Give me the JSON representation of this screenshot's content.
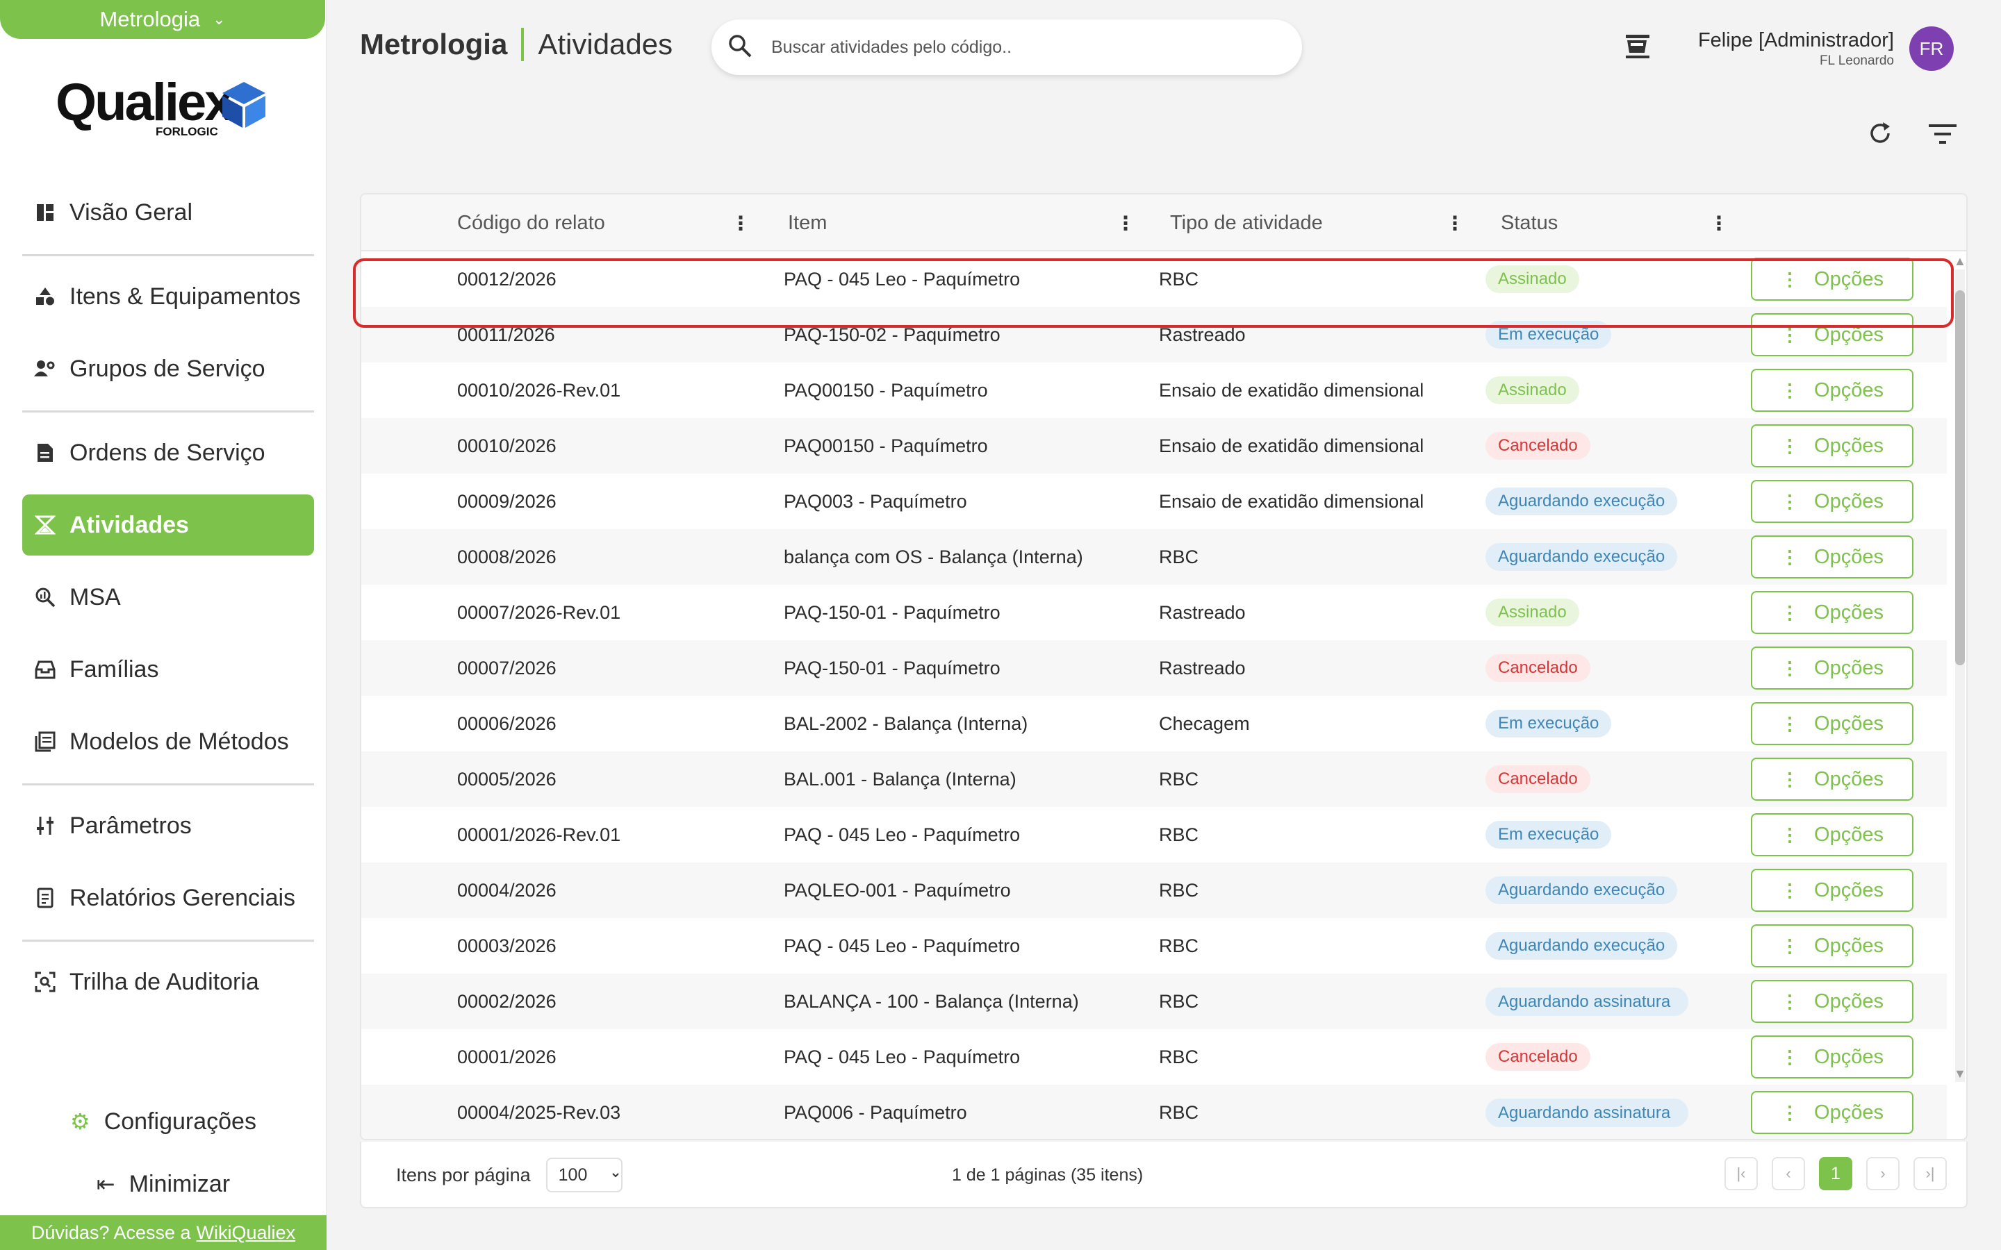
{
  "app": {
    "module": "Metrologia",
    "logo_text": "Qualiex",
    "logo_sub": "FORLOGIC"
  },
  "sidebar": {
    "items": [
      {
        "label": "Visão Geral",
        "icon": "dashboard-icon"
      },
      {
        "label": "Itens & Equipamentos",
        "icon": "shapes-icon"
      },
      {
        "label": "Grupos de Serviço",
        "icon": "people-gear-icon"
      },
      {
        "label": "Ordens de Serviço",
        "icon": "document-icon"
      },
      {
        "label": "Atividades",
        "icon": "hourglass-icon",
        "active": true
      },
      {
        "label": "MSA",
        "icon": "magnifier-chart-icon"
      },
      {
        "label": "Famílias",
        "icon": "tray-icon"
      },
      {
        "label": "Modelos de Métodos",
        "icon": "book-icon"
      },
      {
        "label": "Parâmetros",
        "icon": "sliders-icon"
      },
      {
        "label": "Relatórios Gerenciais",
        "icon": "report-icon"
      },
      {
        "label": "Trilha de Auditoria",
        "icon": "audit-scan-icon"
      }
    ],
    "settings_label": "Configurações",
    "minimize_label": "Minimizar",
    "help_text": "Dúvidas? Acesse a",
    "help_link": "WikiQualiex"
  },
  "header": {
    "module_title": "Metrologia",
    "page_title": "Atividades",
    "search_placeholder": "Buscar atividades pelo código..",
    "user_name": "Felipe [Administrador]",
    "user_org": "FL Leonardo",
    "avatar_initials": "FR"
  },
  "table": {
    "columns": [
      "Código do relato",
      "Item",
      "Tipo de atividade",
      "Status"
    ],
    "options_label": "Opções",
    "rows": [
      {
        "code": "00012/2026",
        "item": "PAQ - 045 Leo - Paquímetro",
        "type": "RBC",
        "status": "Assinado",
        "status_kind": "assinado"
      },
      {
        "code": "00011/2026",
        "item": "PAQ-150-02 - Paquímetro",
        "type": "Rastreado",
        "status": "Em execução",
        "status_kind": "exec"
      },
      {
        "code": "00010/2026-Rev.01",
        "item": "PAQ00150 - Paquímetro",
        "type": "Ensaio de exatidão dimensional",
        "status": "Assinado",
        "status_kind": "assinado"
      },
      {
        "code": "00010/2026",
        "item": "PAQ00150 - Paquímetro",
        "type": "Ensaio de exatidão dimensional",
        "status": "Cancelado",
        "status_kind": "cancel"
      },
      {
        "code": "00009/2026",
        "item": "PAQ003 - Paquímetro",
        "type": "Ensaio de exatidão dimensional",
        "status": "Aguardando execução",
        "status_kind": "aguard"
      },
      {
        "code": "00008/2026",
        "item": "balança com OS - Balança (Interna)",
        "type": "RBC",
        "status": "Aguardando execução",
        "status_kind": "aguard"
      },
      {
        "code": "00007/2026-Rev.01",
        "item": "PAQ-150-01 - Paquímetro",
        "type": "Rastreado",
        "status": "Assinado",
        "status_kind": "assinado"
      },
      {
        "code": "00007/2026",
        "item": "PAQ-150-01 - Paquímetro",
        "type": "Rastreado",
        "status": "Cancelado",
        "status_kind": "cancel"
      },
      {
        "code": "00006/2026",
        "item": "BAL-2002 - Balança (Interna)",
        "type": "Checagem",
        "status": "Em execução",
        "status_kind": "exec"
      },
      {
        "code": "00005/2026",
        "item": "BAL.001 - Balança (Interna)",
        "type": "RBC",
        "status": "Cancelado",
        "status_kind": "cancel"
      },
      {
        "code": "00001/2026-Rev.01",
        "item": "PAQ - 045 Leo - Paquímetro",
        "type": "RBC",
        "status": "Em execução",
        "status_kind": "exec"
      },
      {
        "code": "00004/2026",
        "item": "PAQLEO-001 - Paquímetro",
        "type": "RBC",
        "status": "Aguardando execução",
        "status_kind": "aguard"
      },
      {
        "code": "00003/2026",
        "item": "PAQ - 045 Leo - Paquímetro",
        "type": "RBC",
        "status": "Aguardando execução",
        "status_kind": "aguard"
      },
      {
        "code": "00002/2026",
        "item": "BALANÇA - 100 - Balança (Interna)",
        "type": "RBC",
        "status": "Aguardando assinatura",
        "status_kind": "aguard wrap"
      },
      {
        "code": "00001/2026",
        "item": "PAQ - 045 Leo - Paquímetro",
        "type": "RBC",
        "status": "Cancelado",
        "status_kind": "cancel"
      },
      {
        "code": "00004/2025-Rev.03",
        "item": "PAQ006 - Paquímetro",
        "type": "RBC",
        "status": "Aguardando assinatura",
        "status_kind": "aguard wrap"
      }
    ]
  },
  "pagination": {
    "per_page_label": "Itens por página",
    "per_page_value": "100",
    "info": "1 de 1 páginas (35 itens)",
    "current_page": "1"
  },
  "colors": {
    "brand_green": "#7dc24b",
    "highlight_red": "#d82c2c",
    "avatar_purple": "#7e3fb1"
  }
}
